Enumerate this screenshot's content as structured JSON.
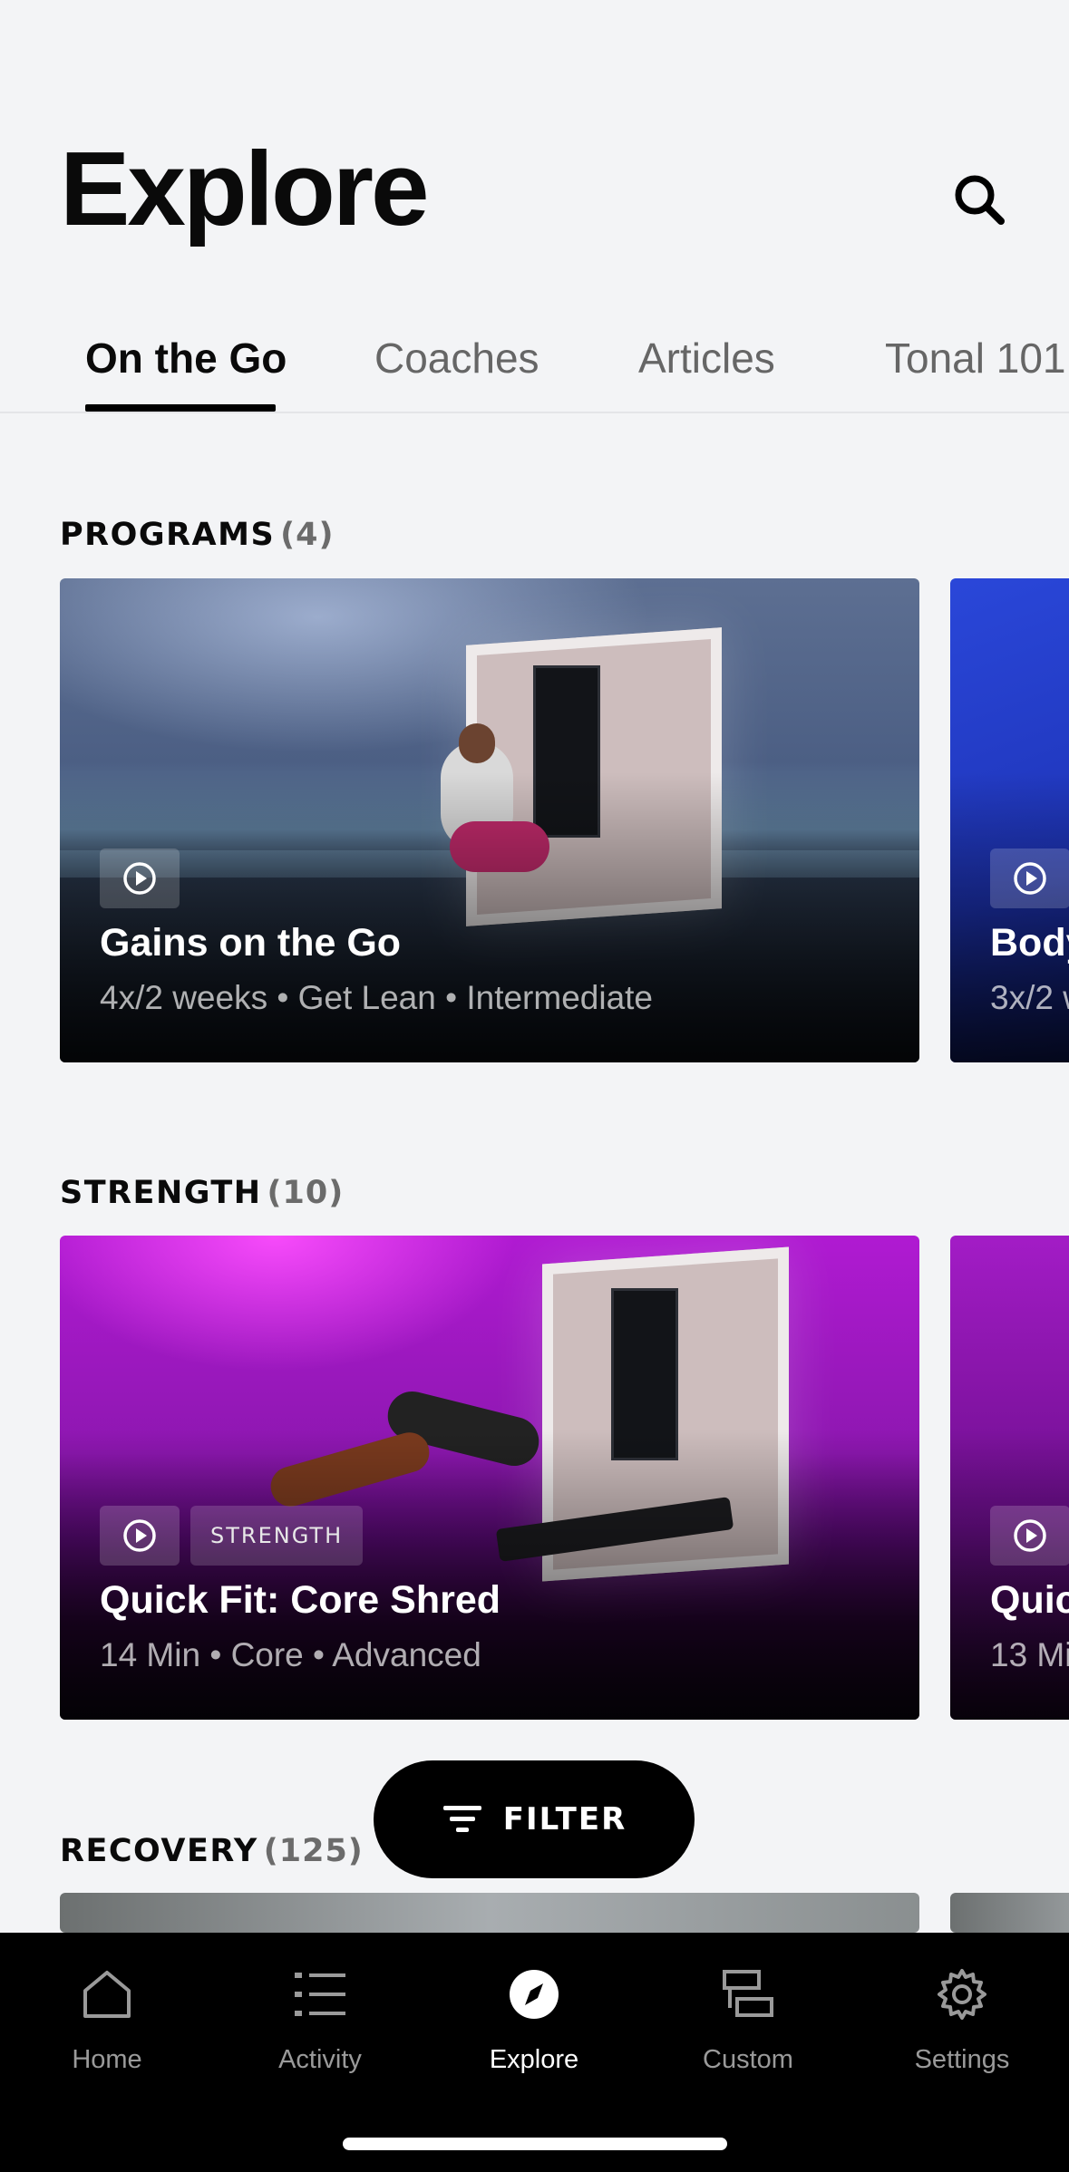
{
  "page": {
    "title": "Explore",
    "search_icon": "search-icon"
  },
  "tabs": [
    {
      "label": "On the Go",
      "active": true
    },
    {
      "label": "Coaches",
      "active": false
    },
    {
      "label": "Articles",
      "active": false
    },
    {
      "label": "Tonal 101",
      "active": false
    }
  ],
  "sections": {
    "programs": {
      "title": "PROGRAMS",
      "count": "(4)",
      "cards": [
        {
          "title": "Gains on the Go",
          "meta": "4x/2 weeks • Get Lean • Intermediate",
          "icon": "play-icon"
        },
        {
          "title": "Body",
          "meta": "3x/2 w",
          "icon": "play-icon"
        }
      ]
    },
    "strength": {
      "title": "STRENGTH",
      "count": "(10)",
      "cards": [
        {
          "title": "Quick Fit: Core Shred",
          "meta": "14 Min • Core • Advanced",
          "tag": "STRENGTH",
          "icon": "play-icon"
        },
        {
          "title": "Quic",
          "meta": "13 Mi",
          "icon": "play-icon"
        }
      ]
    },
    "recovery": {
      "title": "RECOVERY",
      "count": "(125)"
    }
  },
  "filter": {
    "label": "FILTER",
    "icon": "filter-icon"
  },
  "tabbar": [
    {
      "label": "Home",
      "icon": "home-icon",
      "active": false
    },
    {
      "label": "Activity",
      "icon": "list-icon",
      "active": false
    },
    {
      "label": "Explore",
      "icon": "compass-icon",
      "active": true
    },
    {
      "label": "Custom",
      "icon": "custom-layout-icon",
      "active": false
    },
    {
      "label": "Settings",
      "icon": "gear-icon",
      "active": false
    }
  ],
  "colors": {
    "background": "#f3f4f6",
    "tabbar": "#000000",
    "accent": "#000000",
    "strength_card": "#9a18c0",
    "programs_card": "#4c5f84"
  }
}
